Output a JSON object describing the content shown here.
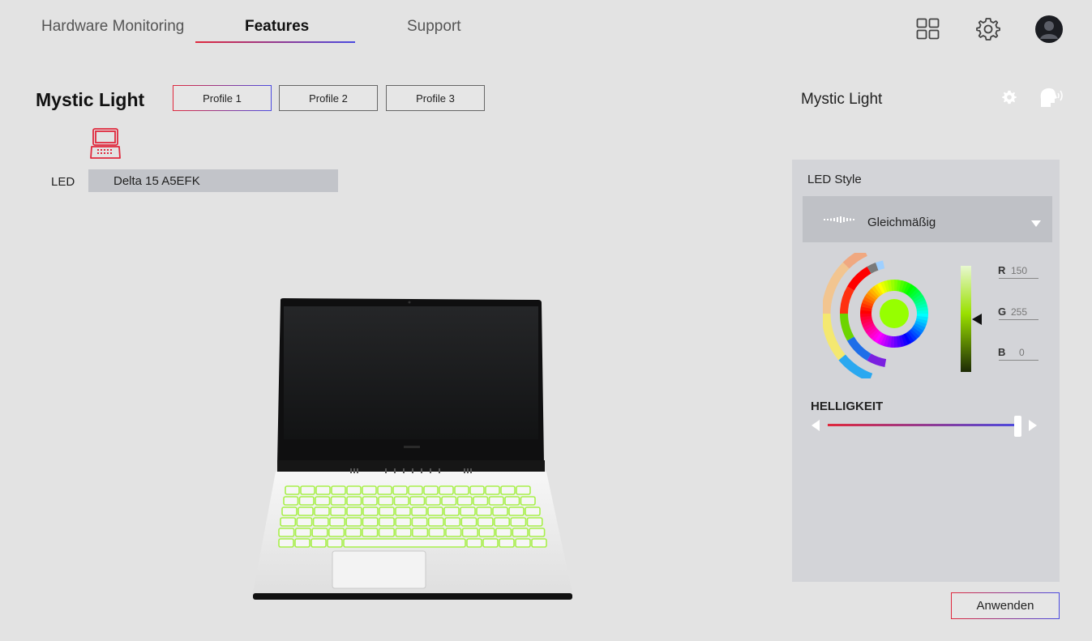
{
  "nav": {
    "tabs": [
      {
        "label": "Hardware Monitoring"
      },
      {
        "label": "Features"
      },
      {
        "label": "Support"
      }
    ],
    "active_tab": "Features",
    "icons": [
      "grid-icon",
      "gear-icon",
      "user-avatar-icon"
    ]
  },
  "main": {
    "title": "Mystic Light",
    "profiles": [
      "Profile 1",
      "Profile 2",
      "Profile 3"
    ],
    "active_profile": "Profile 1",
    "led_label": "LED",
    "device_name": "Delta 15 A5EFK",
    "device_icon": "laptop-icon"
  },
  "side": {
    "title": "Mystic Light",
    "icons": [
      "gear-icon",
      "voice-control-icon"
    ],
    "led_style_label": "LED Style",
    "led_style_value": "Gleichmäßig",
    "rgb": {
      "r_label": "R",
      "r": "150",
      "g_label": "G",
      "g": "255",
      "b_label": "B",
      "b": "0"
    },
    "selected_color": "#96ff00",
    "brightness_label": "HELLIGKEIT",
    "brightness_value": 0.99,
    "apply_label": "Anwenden"
  },
  "colors": {
    "accent_red": "#e0283c",
    "accent_blue": "#4a4ae0",
    "keyboard_glow": "#a8f04a"
  }
}
